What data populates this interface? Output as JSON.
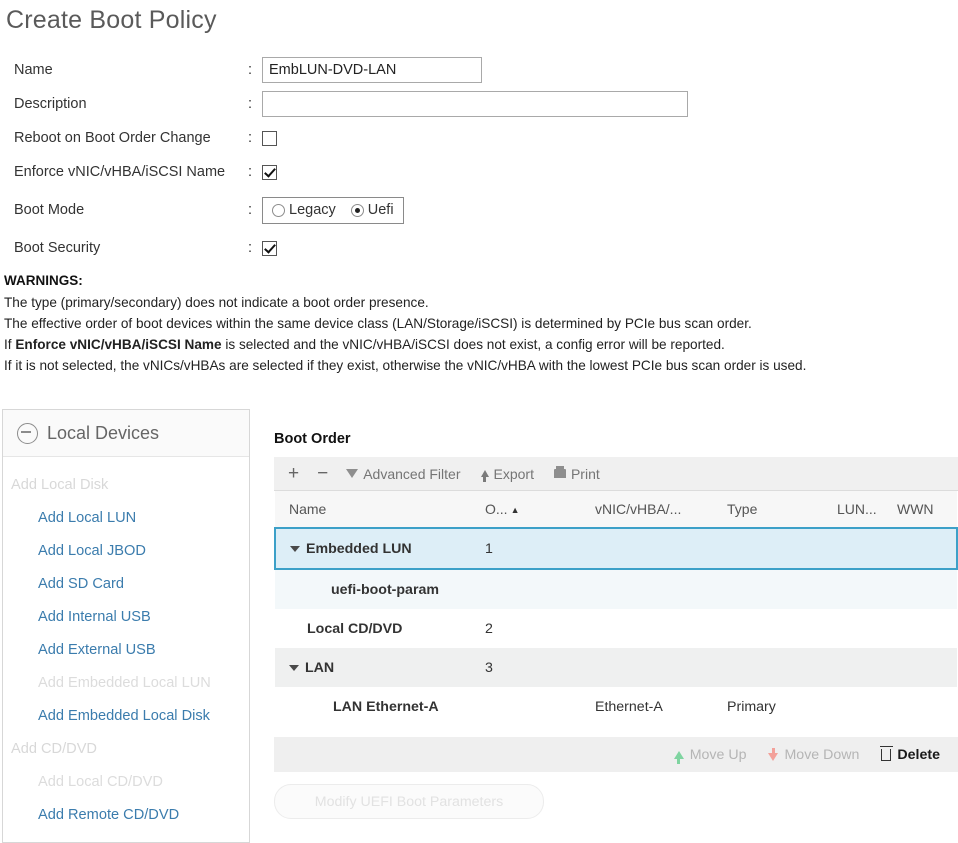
{
  "page_title": "Create Boot Policy",
  "form": {
    "name": {
      "label": "Name",
      "value": "EmbLUN-DVD-LAN",
      "placeholder": ""
    },
    "description": {
      "label": "Description",
      "value": "",
      "placeholder": ""
    },
    "reboot_on_change": {
      "label": "Reboot on Boot Order Change",
      "checked": false
    },
    "enforce_name": {
      "label": "Enforce vNIC/vHBA/iSCSI Name",
      "checked": true
    },
    "boot_mode": {
      "label": "Boot Mode",
      "options": [
        "Legacy",
        "Uefi"
      ],
      "selected": "Uefi"
    },
    "boot_security": {
      "label": "Boot Security",
      "checked": true
    },
    "colon": ":"
  },
  "warnings": {
    "heading": "WARNINGS:",
    "lines": [
      {
        "pre": "The type (primary/secondary) does not indicate a boot order presence.",
        "bold": "",
        "post": ""
      },
      {
        "pre": "The effective order of boot devices within the same device class (LAN/Storage/iSCSI) is determined by PCIe bus scan order.",
        "bold": "",
        "post": ""
      },
      {
        "pre": "If ",
        "bold": "Enforce vNIC/vHBA/iSCSI Name",
        "post": " is selected and the vNIC/vHBA/iSCSI does not exist, a config error will be reported."
      },
      {
        "pre": "If it is not selected, the vNICs/vHBAs are selected if they exist, otherwise the vNIC/vHBA with the lowest PCIe bus scan order is used.",
        "bold": "",
        "post": ""
      }
    ]
  },
  "local_devices": {
    "title": "Local Devices",
    "collapse_icon": "minus-circle-icon",
    "items": [
      {
        "label": "Add Local Disk",
        "style": "group"
      },
      {
        "label": "Add Local LUN",
        "style": "link"
      },
      {
        "label": "Add Local JBOD",
        "style": "link"
      },
      {
        "label": "Add SD Card",
        "style": "link"
      },
      {
        "label": "Add Internal USB",
        "style": "link"
      },
      {
        "label": "Add External USB",
        "style": "link"
      },
      {
        "label": "Add Embedded Local LUN",
        "style": "disabled"
      },
      {
        "label": "Add Embedded Local Disk",
        "style": "link"
      },
      {
        "label": "Add CD/DVD",
        "style": "group"
      },
      {
        "label": "Add Local CD/DVD",
        "style": "disabled"
      },
      {
        "label": "Add Remote CD/DVD",
        "style": "link"
      }
    ]
  },
  "boot_order": {
    "title": "Boot Order",
    "toolbar": {
      "add": "+",
      "remove": "−",
      "advanced_filter": "Advanced Filter",
      "export": "Export",
      "print": "Print"
    },
    "columns": [
      "Name",
      "O...",
      "vNIC/vHBA/...",
      "Type",
      "LUN...",
      "WWN"
    ],
    "sorted_column": "O...",
    "sort_direction": "asc",
    "rows": [
      {
        "name": "Embedded LUN",
        "order": "1",
        "vnic": "",
        "type": "",
        "lun": "",
        "wwn": "",
        "kind": "group",
        "expanded": true,
        "selected": true
      },
      {
        "name": "uefi-boot-param",
        "order": "",
        "vnic": "",
        "type": "",
        "lun": "",
        "wwn": "",
        "kind": "child",
        "expanded": false,
        "selected": false
      },
      {
        "name": "Local CD/DVD",
        "order": "2",
        "vnic": "",
        "type": "",
        "lun": "",
        "wwn": "",
        "kind": "plain",
        "expanded": false,
        "selected": false
      },
      {
        "name": "LAN",
        "order": "3",
        "vnic": "",
        "type": "",
        "lun": "",
        "wwn": "",
        "kind": "group",
        "expanded": true,
        "selected": false
      },
      {
        "name": "LAN Ethernet-A",
        "order": "",
        "vnic": "Ethernet-A",
        "type": "Primary",
        "lun": "",
        "wwn": "",
        "kind": "subrow",
        "expanded": false,
        "selected": false
      }
    ],
    "actions": {
      "move_up": "Move Up",
      "move_down": "Move Down",
      "delete": "Delete"
    },
    "modify_button": "Modify UEFI Boot Parameters"
  },
  "colors": {
    "accent": "#3ca0c8",
    "link": "#3b7cad",
    "selected_row_bg": "#ddeef7",
    "group_row_bg": "#eff0f0",
    "child_row_bg": "#f3f8fa"
  }
}
